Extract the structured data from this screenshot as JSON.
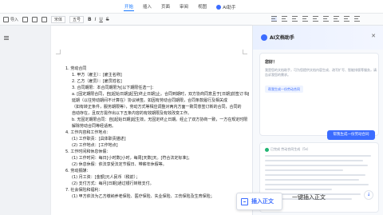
{
  "topbar": {
    "tabs": [
      "开始",
      "插入",
      "页面",
      "审阅",
      "视图"
    ],
    "active_tab": "开始",
    "ai_tab_label": "AI助手"
  },
  "toolbar": {
    "import_label": "导入",
    "font_name": "宋体",
    "font_size": "五号",
    "fmt_bold": "B",
    "fmt_italic": "I",
    "fmt_underline": "U",
    "fmt_strike": "S"
  },
  "document": {
    "lines": [
      {
        "level": "l1",
        "text": "1. 劳动合同"
      },
      {
        "level": "l2",
        "text": "1. 甲方（雇主）：[雇主名称]"
      },
      {
        "level": "l2",
        "text": "2. 乙方（雇员）：[雇员姓名]"
      },
      {
        "level": "l2",
        "text": "3. 合同期限：本合同期限为[以下期限任选一]："
      },
      {
        "level": "l3",
        "text": "a. [固定期限合同，自[起始日期]起至[终止日期]止。合同到期时，双方协商同意且于[日期]前签订书面"
      },
      {
        "level": "l3",
        "text": "延期（以往劳动期间不计算在）协议续签。如因有劳动合同期限，合同条款履行及相关成"
      },
      {
        "level": "l3",
        "text": "（如有转正条件，服务期限等），劳动方式等相应调整对两内方面一致同意签订新的合同，合同的"
      },
      {
        "level": "l3",
        "text": "自动存在，且双方需作出以下五条内容的有效期限及有效改变工作。"
      },
      {
        "level": "l3",
        "text": "b. 无固定期限合同：自[起始日期]起生效，无固定终止日期。经止了双方协商一致，一方在规定时限"
      },
      {
        "level": "l3",
        "text": "解除劳动合同等经适用。"
      },
      {
        "level": "l1",
        "text": "4. 工作内容和工作地点："
      },
      {
        "level": "l2",
        "text": "(1) 工作职责：[具体职责描述]"
      },
      {
        "level": "l2",
        "text": "(2) 工作地点：[工作地点]"
      },
      {
        "level": "l1",
        "text": "5. 工作时间和休息休假："
      },
      {
        "level": "l2",
        "text": "(1) 工作时间：每日[小时数]小时，每周[天数]天。[符合法定标准]；"
      },
      {
        "level": "l2",
        "text": "(2) 休息休假：依法享受法定节假日、带薪年休假等。"
      },
      {
        "level": "l1",
        "text": "6. 劳动报酬："
      },
      {
        "level": "l2",
        "text": "(1) 月工资：[金额]元人民币（税前）；"
      },
      {
        "level": "l2",
        "text": "(2) 支付方式：每月[日期]通过银行转账支付。"
      },
      {
        "level": "l1",
        "text": "7. 社会保险和福利："
      },
      {
        "level": "l2",
        "text": "(1) 甲方依法为乙方缴纳养老保险、医疗保险、失业保险、工伤保险及生育保险；"
      }
    ]
  },
  "panel": {
    "title": "AI文档助手",
    "card1": {
      "heading": "您好！",
      "desc": "我是您的文档助手，可为您提供文档内容生成、改写扩写、智能排版等服务，请告诉我您的需求。",
      "chip": "帮我生成一份劳动合同",
      "cta": "帮我生成一份劳动合同"
    },
    "card2": {
      "status": "已完成 劳动合同生成（5s）"
    }
  },
  "popup": {
    "insert_label": "插入正文",
    "one_click_label": "一键插入正文"
  }
}
